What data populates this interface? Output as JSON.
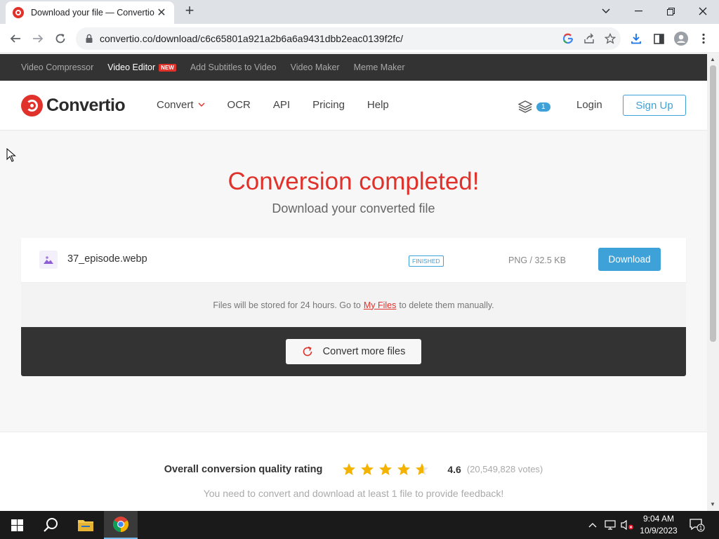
{
  "browser": {
    "tab_title": "Download your file — Convertio",
    "tab_close": "✕",
    "new_tab": "+",
    "url": "convertio.co/download/c6c65801a921a2b6a6a9431dbb2eac0139f2fc/"
  },
  "promo_bar": {
    "items": [
      {
        "label": "Video Compressor",
        "active": false
      },
      {
        "label": "Video Editor",
        "active": true,
        "badge": "NEW"
      },
      {
        "label": "Add Subtitles to Video",
        "active": false
      },
      {
        "label": "Video Maker",
        "active": false
      },
      {
        "label": "Meme Maker",
        "active": false
      }
    ]
  },
  "header": {
    "logo_text": "Convertio",
    "nav": [
      "Convert",
      "OCR",
      "API",
      "Pricing",
      "Help"
    ],
    "files_count": "1",
    "login": "Login",
    "signup": "Sign Up"
  },
  "hero": {
    "title": "Conversion completed!",
    "subtitle": "Download your converted file"
  },
  "file": {
    "name": "37_episode.webp",
    "status": "FINISHED",
    "meta": "PNG / 32.5 KB",
    "download_label": "Download"
  },
  "storage_note": {
    "before": "Files will be stored for 24 hours. Go to",
    "link": "My Files",
    "after": "to delete them manually."
  },
  "convert_more": {
    "label": "Convert more files"
  },
  "rating": {
    "label": "Overall conversion quality rating",
    "score": "4.6",
    "votes": "(20,549,828 votes)",
    "stars": 4.6,
    "note": "You need to convert and download at least 1 file to provide feedback!"
  },
  "taskbar": {
    "time": "9:04 AM",
    "date": "10/9/2023",
    "notification_count": "1"
  },
  "colors": {
    "brand_red": "#e0312b",
    "accent_blue": "#3ea2d8",
    "dark_panel": "#333333",
    "star_gold": "#f5b301"
  }
}
